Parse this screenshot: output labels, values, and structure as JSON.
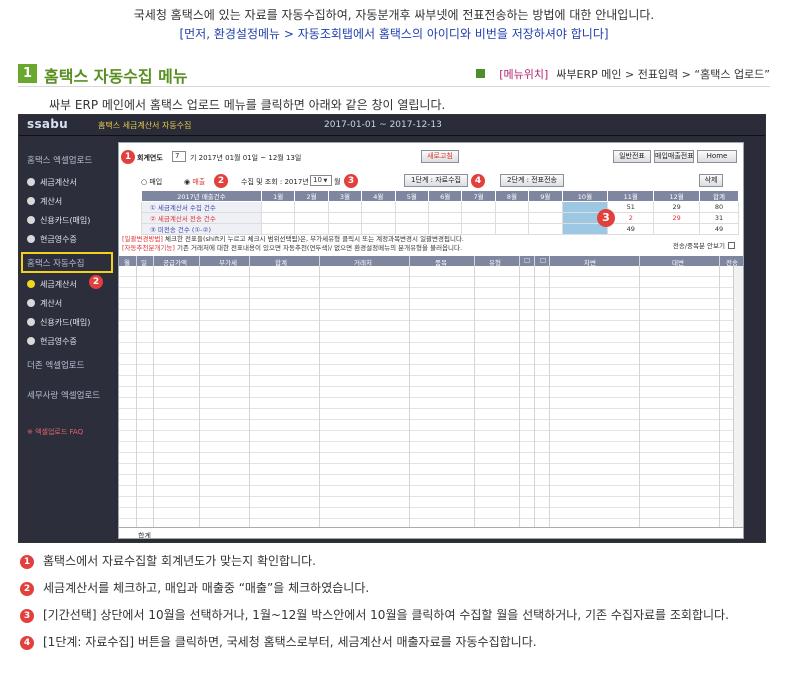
{
  "intro": {
    "line1": "국세청 홈택스에 있는 자료를 자동수집하여, 자동분개후 싸부넷에 전표전송하는 방법에 대한 안내입니다.",
    "line2": "[먼저, 환경설정메뉴 > 자동조회탭에서 홈택스의 아이디와 비번을 저장하셔야 합니다]"
  },
  "section": {
    "number": "1",
    "title": "홈택스 자동수집 메뉴",
    "menu_location_tag": "[메뉴위치]",
    "menu_location_path": "싸부ERP 메인 > 전표입력 > “홈택스 업로드”",
    "description": "싸부 ERP 메인에서 홈택스 업로드 메뉴를 클릭하면 아래와 같은 창이 열립니다."
  },
  "app": {
    "logo": "ssabu",
    "title": "홈택스 세금계산서 자동수집",
    "period": "2017-01-01 ~ 2017-12-13",
    "sidebar": {
      "group1": "홈택스 엑셀업로드",
      "group1_items": [
        "세금계산서",
        "계산서",
        "신용카드(매입)",
        "현금영수증"
      ],
      "group2": "홈택스 자동수집",
      "group2_items": [
        "세금계산서",
        "계산서",
        "신용카드(매입)",
        "현금영수증"
      ],
      "group3": "더존 엑셀업로드",
      "group4": "세무사랑 엑셀업로드",
      "faq": "※ 엑셀업로드 FAQ"
    },
    "form": {
      "fiscal_label": "회계연도",
      "fiscal_value": "7",
      "fiscal_text": "기 2017년   01월 01일 ~ 12월 13일",
      "refresh_button": "새로고침",
      "btn_general": "일반전표",
      "btn_purchase_sales": "매입매출전표",
      "btn_home": "Home",
      "radio_purchase": "매입",
      "radio_sales": "매출",
      "collect_label": "수집 및 조회 : 2017년",
      "month_value": "10",
      "month_suffix": "월",
      "step1_button": "1단계 : 자료수집",
      "step2_button": "2단계 : 전표전송",
      "delete_button": "삭제"
    },
    "summary": {
      "header_first": "2017년 매출건수",
      "months": [
        "1월",
        "2월",
        "3월",
        "4월",
        "5월",
        "6월",
        "7월",
        "8월",
        "9월",
        "10월",
        "11월",
        "12월",
        "합계"
      ],
      "rows": [
        {
          "label": "① 세금계산서 수집 건수",
          "values": [
            "",
            "",
            "",
            "",
            "",
            "",
            "",
            "",
            "",
            "",
            "51",
            "29",
            "80"
          ]
        },
        {
          "label": "② 세금계산서 전송 건수",
          "values": [
            "",
            "",
            "",
            "",
            "",
            "",
            "",
            "",
            "",
            "",
            "2",
            "29",
            "31"
          ]
        },
        {
          "label": "③ 미전송 건수 (①-②)",
          "values": [
            "",
            "",
            "",
            "",
            "",
            "",
            "",
            "",
            "",
            "",
            "49",
            "",
            "49"
          ]
        }
      ]
    },
    "notes": {
      "line1_tag": "[일괄변경방법]",
      "line1_text": " 체크한 전표들(shift키 누르고 체크시 범위선택됨)은, 부가세유형 클릭시 또는 계정과목변경시 일괄변경됩니다.",
      "line2_tag": "[자동추천분개기능]",
      "line2_text": " 기존 거래처에 대한 전표내용이 있으면 자동추천(연두색)/ 없으면 환경설정메뉴의 분개유형을 불러옵니다."
    },
    "dup_check_label": "전송/중복분 안보기",
    "grid_headers": [
      "월",
      "일",
      "공급가액",
      "부가세",
      "합계",
      "거래처",
      "품목",
      "유형",
      "",
      "",
      "차변",
      "대변",
      "전송"
    ],
    "footer_label": "합계"
  },
  "callouts": [
    "1",
    "2",
    "3",
    "4"
  ],
  "steps": [
    {
      "num": "1",
      "text": "홈택스에서 자료수집할 회계년도가 맞는지 확인합니다."
    },
    {
      "num": "2",
      "text": "세금계산서를 체크하고, 매입과 매출중  “매출”을 체크하였습니다."
    },
    {
      "num": "3",
      "text": "[기간선택] 상단에서 10월을 선택하거나,  1월~12월 박스안에서 10월을 클릭하여 수집할 월을 선택하거나, 기존 수집자료를 조회합니다."
    },
    {
      "num": "4",
      "text": "[1단계: 자료수집] 버튼을 클릭하면,  국세청 홈택스로부터, 세금계산서 매출자료를 자동수집합니다."
    }
  ],
  "colors": {
    "accent_green": "#5a8f22",
    "callout_red": "#e2403d",
    "sidebar_bg": "#2c2f3b",
    "active_yellow": "#f2d21c",
    "grid_header": "#7f86a0"
  }
}
